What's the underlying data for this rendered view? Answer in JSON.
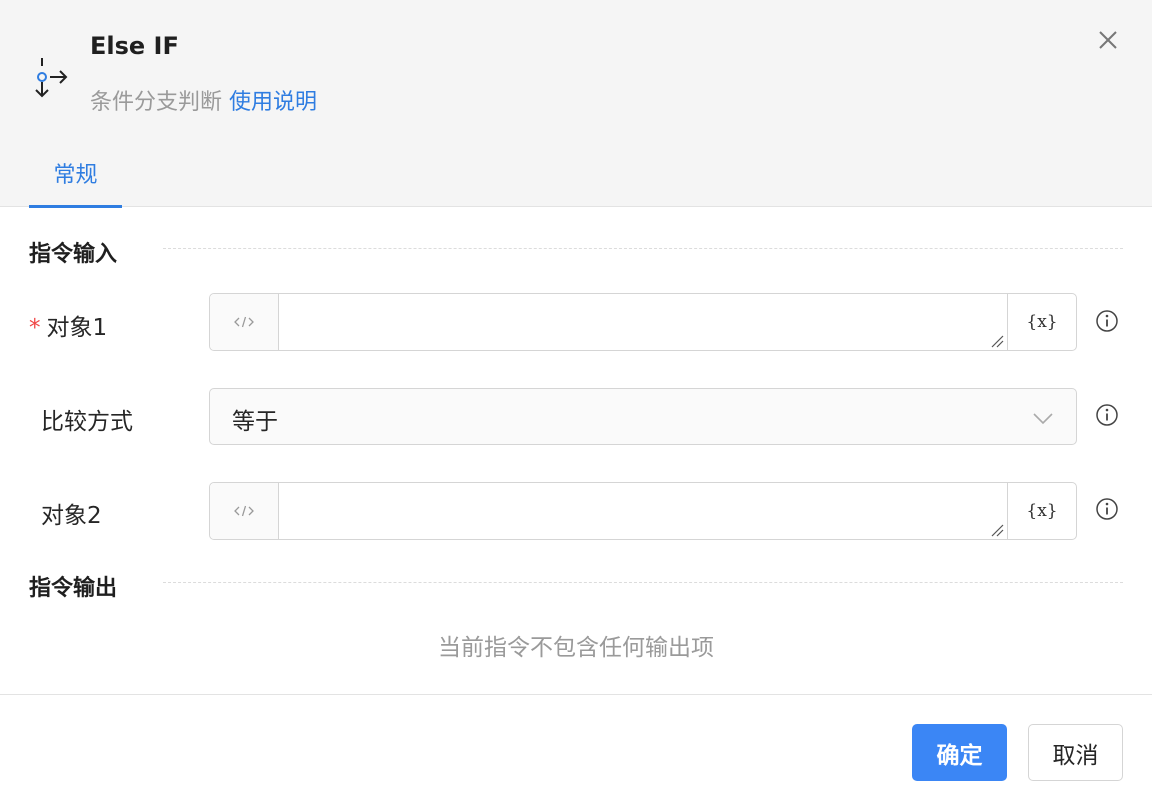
{
  "dialog": {
    "title": "Else IF",
    "subtitle": "条件分支判断",
    "help_link": "使用说明",
    "icon": "branch-icon"
  },
  "tabs": [
    {
      "label": "常规",
      "active": true
    }
  ],
  "input_section": {
    "title": "指令输入",
    "fields": [
      {
        "label": "对象1",
        "required": true,
        "value": "",
        "var_button": "{x}"
      },
      {
        "label": "比较方式",
        "required": false,
        "value": "等于"
      },
      {
        "label": "对象2",
        "required": false,
        "value": "",
        "var_button": "{x}"
      }
    ]
  },
  "output_section": {
    "title": "指令输出",
    "empty_text": "当前指令不包含任何输出项"
  },
  "footer": {
    "confirm_label": "确定",
    "cancel_label": "取消"
  },
  "colors": {
    "accent": "#2f7de1",
    "primary_button": "#3b86f5",
    "required": "#f04646"
  }
}
